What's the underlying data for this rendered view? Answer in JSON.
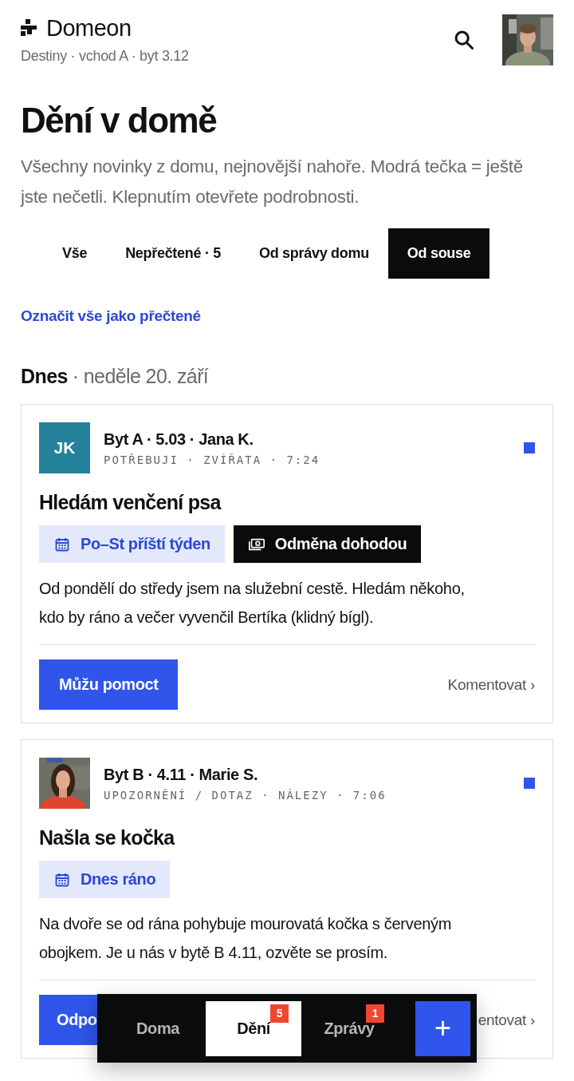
{
  "header": {
    "app_name": "Domeon",
    "location": "Destiny · vchod A · byt 3.12",
    "user_avatar": {
      "kind": "picture"
    }
  },
  "page": {
    "title": "Dění v domě",
    "description": "Všechny novinky z domu, nejnovější nahoře. Modrá tečka = ještě jste nečetli. Klepnutím otevřete podrobnosti."
  },
  "tabs": [
    {
      "label": "Vše",
      "selected": false
    },
    {
      "label": "Nepřečtené · 5",
      "selected": false
    },
    {
      "label": "Od správy domu",
      "selected": false
    },
    {
      "label": "Od souse",
      "selected": true
    }
  ],
  "mark_all_read": "Označit vše jako přečtené",
  "day": {
    "label": "Dnes",
    "date": "· neděle 20. září"
  },
  "posts": [
    {
      "avatar": {
        "kind": "initials",
        "initials": "JK",
        "color": "#23819a"
      },
      "author": "Byt A · 5.03 · Jana K.",
      "meta": "POTŘEBUJI · ZVÍŘATA · 7:24",
      "unread": true,
      "title": "Hledám venčení psa",
      "tags": [
        {
          "kind": "date",
          "label": "Po–St příští týden"
        },
        {
          "kind": "reward",
          "label": "Odměna dohodou"
        }
      ],
      "body": "Od pondělí do středy jsem na služební cestě. Hledám někoho, kdo by ráno a večer vyvenčil Bertíka (klidný bígl).",
      "action": "Můžu pomoct",
      "comment": "Komentovat ›"
    },
    {
      "avatar": {
        "kind": "picture"
      },
      "author": "Byt B · 4.11 · Marie S.",
      "meta": "UPOZORNĚNÍ / DOTAZ · NÁLEZY · 7:06",
      "unread": true,
      "title": "Našla se kočka",
      "tags": [
        {
          "kind": "date",
          "label": "Dnes ráno"
        }
      ],
      "body": "Na dvoře se od rána pohybuje mourovatá kočka s červeným obojkem. Je u nás v bytě B 4.11, ozvěte se prosím.",
      "action": "Odpo",
      "comment": "entovat ›"
    }
  ],
  "bottom_nav": {
    "items": [
      {
        "label": "Doma",
        "selected": false
      },
      {
        "label": "Dění",
        "selected": true,
        "badge": "5"
      },
      {
        "label": "Zprávy",
        "selected": false,
        "badge": "1"
      }
    ],
    "add_button": "+"
  }
}
